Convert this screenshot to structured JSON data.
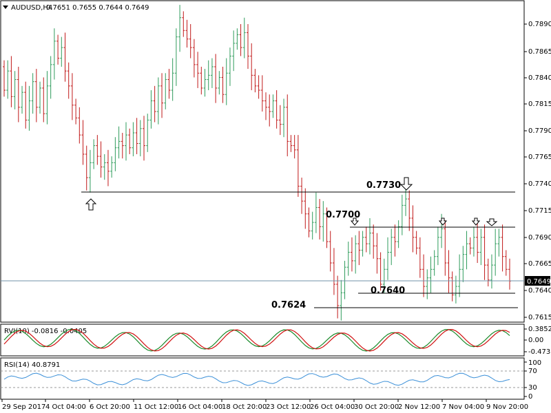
{
  "header": {
    "symbol": "AUDUSD,H4",
    "ohlc": "0.7651 0.7655 0.7644 0.7649"
  },
  "price_axis": {
    "ticks": [
      "0.7890",
      "0.7865",
      "0.7840",
      "0.7815",
      "0.7790",
      "0.7765",
      "0.7740",
      "0.7715",
      "0.7690",
      "0.7665",
      "0.7640",
      "0.7615"
    ],
    "current": "0.7649"
  },
  "levels": {
    "l7730": "0.7730",
    "l7700": "0.7700",
    "l7640": "0.7640",
    "l7624": "0.7624"
  },
  "rvi": {
    "label": "RVI(10) -0.0816 -0.0405",
    "ticks": [
      "0.3852",
      "0.00",
      "-0.4733"
    ]
  },
  "rsi": {
    "label": "RSI(14) 40.8791",
    "ticks": [
      "100",
      "70",
      "30",
      "0"
    ]
  },
  "time_axis": [
    "29 Sep 2017",
    "4 Oct 04:00",
    "6 Oct 20:00",
    "11 Oct 12:00",
    "16 Oct 04:00",
    "18 Oct 20:00",
    "23 Oct 12:00",
    "26 Oct 04:00",
    "30 Oct 20:00",
    "2 Nov 12:00",
    "7 Nov 04:00",
    "9 Nov 20:00"
  ],
  "colors": {
    "bull": "#2e9b5b",
    "bear": "#c01818",
    "rvi_main": "#1a8a2a",
    "rvi_signal": "#d01010",
    "rsi_line": "#3a8fd8",
    "level_line": "#000000",
    "current_line": "#7090a8"
  },
  "chart_data": {
    "type": "bar",
    "title": "AUDUSD,H4",
    "ylim": [
      0.7605,
      0.7915
    ],
    "ylabel": "",
    "xlabel": "",
    "points": [
      [
        0.785,
        0.7828
      ],
      [
        0.7828,
        0.7846
      ],
      [
        0.7846,
        0.7822
      ],
      [
        0.7822,
        0.7838
      ],
      [
        0.7838,
        0.7812
      ],
      [
        0.7812,
        0.7826
      ],
      [
        0.7826,
        0.78
      ],
      [
        0.78,
        0.7818
      ],
      [
        0.7818,
        0.7836
      ],
      [
        0.7836,
        0.7812
      ],
      [
        0.7812,
        0.783
      ],
      [
        0.783,
        0.7806
      ],
      [
        0.7806,
        0.7832
      ],
      [
        0.7832,
        0.7852
      ],
      [
        0.7852,
        0.7874
      ],
      [
        0.7874,
        0.7858
      ],
      [
        0.7858,
        0.7868
      ],
      [
        0.7868,
        0.7846
      ],
      [
        0.7846,
        0.7832
      ],
      [
        0.7832,
        0.7814
      ],
      [
        0.7814,
        0.7802
      ],
      [
        0.7802,
        0.7786
      ],
      [
        0.7786,
        0.7768
      ],
      [
        0.7768,
        0.7746
      ],
      [
        0.7746,
        0.776
      ],
      [
        0.776,
        0.7776
      ],
      [
        0.7776,
        0.7766
      ],
      [
        0.7766,
        0.7756
      ],
      [
        0.7756,
        0.776
      ],
      [
        0.776,
        0.7752
      ],
      [
        0.7752,
        0.776
      ],
      [
        0.776,
        0.7774
      ],
      [
        0.7774,
        0.778
      ],
      [
        0.778,
        0.7776
      ],
      [
        0.7776,
        0.7786
      ],
      [
        0.7786,
        0.7774
      ],
      [
        0.7774,
        0.7788
      ],
      [
        0.7788,
        0.7778
      ],
      [
        0.7778,
        0.7792
      ],
      [
        0.7792,
        0.7776
      ],
      [
        0.7776,
        0.78
      ],
      [
        0.78,
        0.7818
      ],
      [
        0.7818,
        0.7808
      ],
      [
        0.7808,
        0.7832
      ],
      [
        0.7832,
        0.7816
      ],
      [
        0.7816,
        0.7838
      ],
      [
        0.7838,
        0.7828
      ],
      [
        0.7828,
        0.7844
      ],
      [
        0.7844,
        0.7878
      ],
      [
        0.7878,
        0.7896
      ],
      [
        0.7896,
        0.7884
      ],
      [
        0.7884,
        0.7876
      ],
      [
        0.7876,
        0.7868
      ],
      [
        0.7868,
        0.7852
      ],
      [
        0.7852,
        0.7844
      ],
      [
        0.7844,
        0.783
      ],
      [
        0.783,
        0.7838
      ],
      [
        0.7838,
        0.7842
      ],
      [
        0.7842,
        0.785
      ],
      [
        0.785,
        0.783
      ],
      [
        0.783,
        0.784
      ],
      [
        0.784,
        0.7824
      ],
      [
        0.7824,
        0.7844
      ],
      [
        0.7844,
        0.786
      ],
      [
        0.786,
        0.7872
      ],
      [
        0.7872,
        0.788
      ],
      [
        0.788,
        0.7868
      ],
      [
        0.7868,
        0.7882
      ],
      [
        0.7882,
        0.786
      ],
      [
        0.786,
        0.7842
      ],
      [
        0.7842,
        0.7832
      ],
      [
        0.7832,
        0.7828
      ],
      [
        0.7828,
        0.7818
      ],
      [
        0.7818,
        0.7812
      ],
      [
        0.7812,
        0.7808
      ],
      [
        0.7808,
        0.7818
      ],
      [
        0.7818,
        0.78
      ],
      [
        0.78,
        0.7796
      ],
      [
        0.7796,
        0.7812
      ],
      [
        0.7812,
        0.778
      ],
      [
        0.778,
        0.7776
      ],
      [
        0.7776,
        0.7772
      ],
      [
        0.7772,
        0.7738
      ],
      [
        0.7738,
        0.7724
      ],
      [
        0.7724,
        0.7712
      ],
      [
        0.7712,
        0.7696
      ],
      [
        0.7696,
        0.7704
      ],
      [
        0.7704,
        0.7718
      ],
      [
        0.7718,
        0.77
      ],
      [
        0.77,
        0.7712
      ],
      [
        0.7712,
        0.7686
      ],
      [
        0.7686,
        0.7666
      ],
      [
        0.7666,
        0.7646
      ],
      [
        0.7646,
        0.7626
      ],
      [
        0.7626,
        0.7638
      ],
      [
        0.7638,
        0.7662
      ],
      [
        0.7662,
        0.7676
      ],
      [
        0.7676,
        0.7668
      ],
      [
        0.7668,
        0.7684
      ],
      [
        0.7684,
        0.7678
      ],
      [
        0.7678,
        0.769
      ],
      [
        0.769,
        0.7684
      ],
      [
        0.7684,
        0.7694
      ],
      [
        0.7694,
        0.7682
      ],
      [
        0.7682,
        0.767
      ],
      [
        0.767,
        0.7646
      ],
      [
        0.7646,
        0.766
      ],
      [
        0.766,
        0.7676
      ],
      [
        0.7676,
        0.769
      ],
      [
        0.769,
        0.7686
      ],
      [
        0.7686,
        0.77
      ],
      [
        0.77,
        0.772
      ],
      [
        0.772,
        0.7726
      ],
      [
        0.7726,
        0.7708
      ],
      [
        0.7708,
        0.769
      ],
      [
        0.769,
        0.768
      ],
      [
        0.768,
        0.766
      ],
      [
        0.766,
        0.7644
      ],
      [
        0.7644,
        0.7652
      ],
      [
        0.7652,
        0.766
      ],
      [
        0.766,
        0.7672
      ],
      [
        0.7672,
        0.769
      ],
      [
        0.769,
        0.7698
      ],
      [
        0.7698,
        0.7666
      ],
      [
        0.7666,
        0.7652
      ],
      [
        0.7652,
        0.7636
      ],
      [
        0.7636,
        0.7644
      ],
      [
        0.7644,
        0.766
      ],
      [
        0.766,
        0.7674
      ],
      [
        0.7674,
        0.7684
      ],
      [
        0.7684,
        0.768
      ],
      [
        0.768,
        0.769
      ],
      [
        0.769,
        0.7676
      ],
      [
        0.7676,
        0.769
      ],
      [
        0.769,
        0.7664
      ],
      [
        0.7664,
        0.765
      ],
      [
        0.765,
        0.7664
      ],
      [
        0.7664,
        0.7684
      ],
      [
        0.7684,
        0.769
      ],
      [
        0.769,
        0.7672
      ],
      [
        0.7672,
        0.766
      ],
      [
        0.766,
        0.7649
      ]
    ]
  }
}
